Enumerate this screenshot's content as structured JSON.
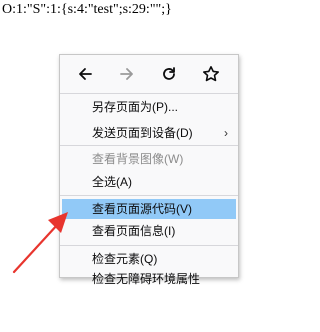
{
  "page": {
    "code_text": "O:1:\"S\":1:{s:4:\"test\";s:29:\"\";}"
  },
  "context_menu": {
    "nav": {
      "back_icon": "back-arrow-icon",
      "forward_icon": "forward-arrow-icon",
      "reload_icon": "reload-icon",
      "bookmark_icon": "star-icon"
    },
    "items": [
      {
        "label": "另存页面为(P)...",
        "disabled": false
      },
      {
        "label": "发送页面到设备(D)",
        "disabled": false,
        "submenu_arrow": "›"
      },
      {
        "label": "查看背景图像(W)",
        "disabled": true
      },
      {
        "label": "全选(A)",
        "disabled": false
      },
      {
        "label": "查看页面源代码(V)",
        "disabled": false,
        "highlighted": true
      },
      {
        "label": "查看页面信息(I)",
        "disabled": false
      },
      {
        "label": "检查元素(Q)",
        "disabled": false
      },
      {
        "label": "检查无障碍环境属性",
        "disabled": false
      }
    ]
  },
  "colors": {
    "highlight": "#91c9f7",
    "annotation_arrow": "#e8352e"
  }
}
